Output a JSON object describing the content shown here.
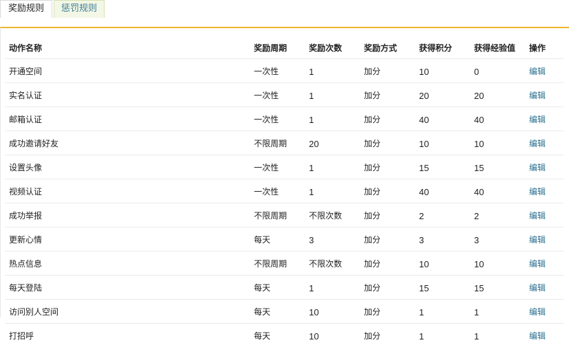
{
  "tabs": [
    {
      "label": "奖励规则",
      "active": true
    },
    {
      "label": "惩罚规则",
      "active": false
    }
  ],
  "colors": {
    "accent_border": "#f0b62a",
    "link": "#2a6f8e",
    "inactive_tab_text": "#3c7c94"
  },
  "table": {
    "headers": [
      "动作名称",
      "奖励周期",
      "奖励次数",
      "奖励方式",
      "获得积分",
      "获得经验值",
      "操作"
    ],
    "rows": [
      {
        "name": "开通空间",
        "cycle": "一次性",
        "times": "1",
        "method": "加分",
        "points": "10",
        "exp": "0",
        "action": "编辑"
      },
      {
        "name": "实名认证",
        "cycle": "一次性",
        "times": "1",
        "method": "加分",
        "points": "20",
        "exp": "20",
        "action": "编辑"
      },
      {
        "name": "邮箱认证",
        "cycle": "一次性",
        "times": "1",
        "method": "加分",
        "points": "40",
        "exp": "40",
        "action": "编辑"
      },
      {
        "name": "成功邀请好友",
        "cycle": "不限周期",
        "times": "20",
        "method": "加分",
        "points": "10",
        "exp": "10",
        "action": "编辑"
      },
      {
        "name": "设置头像",
        "cycle": "一次性",
        "times": "1",
        "method": "加分",
        "points": "15",
        "exp": "15",
        "action": "编辑"
      },
      {
        "name": "视频认证",
        "cycle": "一次性",
        "times": "1",
        "method": "加分",
        "points": "40",
        "exp": "40",
        "action": "编辑"
      },
      {
        "name": "成功举报",
        "cycle": "不限周期",
        "times": "不限次数",
        "method": "加分",
        "points": "2",
        "exp": "2",
        "action": "编辑"
      },
      {
        "name": "更新心情",
        "cycle": "每天",
        "times": "3",
        "method": "加分",
        "points": "3",
        "exp": "3",
        "action": "编辑"
      },
      {
        "name": "热点信息",
        "cycle": "不限周期",
        "times": "不限次数",
        "method": "加分",
        "points": "10",
        "exp": "10",
        "action": "编辑"
      },
      {
        "name": "每天登陆",
        "cycle": "每天",
        "times": "1",
        "method": "加分",
        "points": "15",
        "exp": "15",
        "action": "编辑"
      },
      {
        "name": "访问别人空间",
        "cycle": "每天",
        "times": "10",
        "method": "加分",
        "points": "1",
        "exp": "1",
        "action": "编辑"
      },
      {
        "name": "打招呼",
        "cycle": "每天",
        "times": "10",
        "method": "加分",
        "points": "1",
        "exp": "1",
        "action": "编辑"
      }
    ]
  }
}
